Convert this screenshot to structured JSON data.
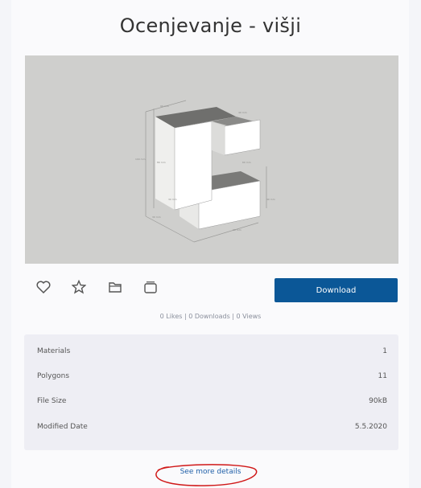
{
  "title": "Ocenjevanje - višji",
  "actions": {
    "icons": [
      "heart-icon",
      "star-icon",
      "folder-icon",
      "collection-icon"
    ],
    "download_label": "Download"
  },
  "stats_line": "0 Likes | 0 Downloads | 0 Views",
  "details": {
    "rows": [
      {
        "label": "Materials",
        "value": "1"
      },
      {
        "label": "Polygons",
        "value": "11"
      },
      {
        "label": "File Size",
        "value": "90kB"
      },
      {
        "label": "Modified Date",
        "value": "5.5.2020"
      }
    ]
  },
  "more_link": "See more details",
  "colors": {
    "download_bg": "#0b5797",
    "annotation": "#d01818",
    "link": "#1f5fa8"
  }
}
